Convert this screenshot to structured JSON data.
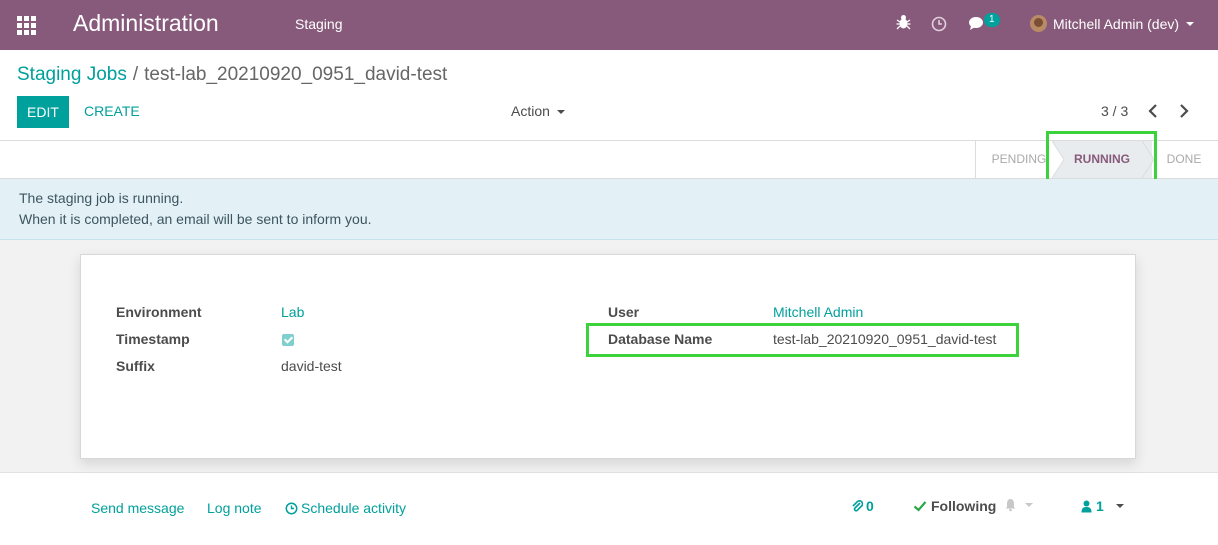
{
  "navbar": {
    "title": "Administration",
    "menu": "Staging",
    "badge_count": "1",
    "user": "Mitchell Admin (dev)",
    "color": "#875a7b"
  },
  "breadcrumb": {
    "parent": "Staging Jobs",
    "separator": "/",
    "current": "test-lab_20210920_0951_david-test"
  },
  "toolbar": {
    "edit_label": "EDIT",
    "create_label": "CREATE",
    "action_label": "Action",
    "pager": "3 / 3",
    "accent": "#00a09d"
  },
  "status": {
    "stages": [
      "PENDING",
      "RUNNING",
      "DONE"
    ],
    "active": "RUNNING"
  },
  "alert": {
    "line1": "The staging job is running.",
    "line2": "When it is completed, an email will be sent to inform you."
  },
  "form": {
    "environment_label": "Environment",
    "environment_value": "Lab",
    "timestamp_label": "Timestamp",
    "timestamp_checked": true,
    "suffix_label": "Suffix",
    "suffix_value": "david-test",
    "user_label": "User",
    "user_value": "Mitchell Admin",
    "dbname_label": "Database Name",
    "dbname_value": "test-lab_20210920_0951_david-test"
  },
  "chatter": {
    "send_message": "Send message",
    "log_note": "Log note",
    "schedule_activity": "Schedule activity",
    "attachments": "0",
    "following": "Following",
    "followers": "1"
  },
  "icons": {
    "apps": "apps-grid-icon",
    "debug": "bug-icon",
    "activity": "clock-icon",
    "messages": "chat-icon",
    "bell": "bell-icon",
    "check": "check-icon",
    "paperclip": "paperclip-icon",
    "user": "user-icon"
  }
}
